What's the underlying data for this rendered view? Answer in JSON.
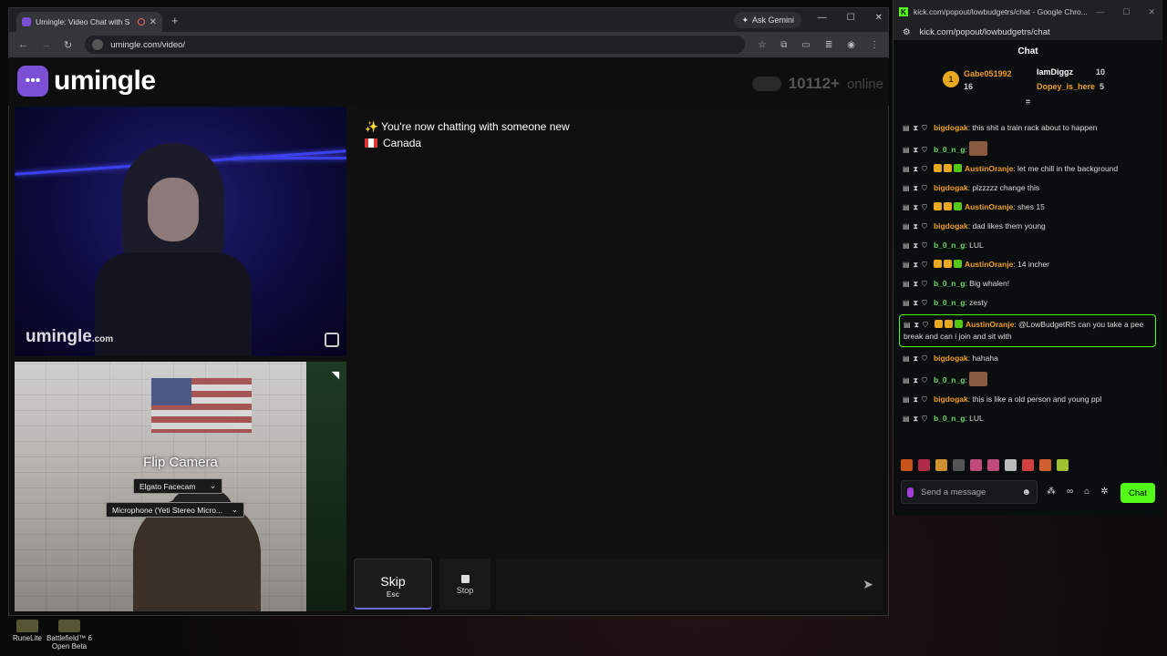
{
  "browser_left": {
    "tab_title": "Umingle: Video Chat with S",
    "ask_gemini": "Ask Gemini",
    "url": "umingle.com/video/"
  },
  "umingle": {
    "logo_text": "umingle",
    "online_count": "10112+",
    "online_label": "online",
    "watermark": "umingle",
    "watermark_suffix": ".com",
    "flip_camera": "Flip Camera",
    "camera_select": "Elgato Facecam",
    "mic_select": "Microphone (Yeti Stereo Micro...",
    "system_message": "✨ You're now chatting with someone new",
    "country": "Canada",
    "skip_label": "Skip",
    "skip_hint": "Esc",
    "stop_label": "Stop"
  },
  "browser_right": {
    "window_title": "kick.com/popout/lowbudgetrs/chat - Google Chro...",
    "url": "kick.com/popout/lowbudgetrs/chat",
    "header": "Chat"
  },
  "leaderboard": [
    {
      "name": "Gabe051992",
      "count": "16",
      "rank": "1"
    },
    {
      "name": "IamDiggz",
      "count": "10"
    },
    {
      "name": "Dopey_is_here",
      "count": "5"
    }
  ],
  "messages": [
    {
      "user": "bigdogak",
      "color": "#f0a020",
      "text": "this shit a train rack about to happen"
    },
    {
      "user": "b_0_n_g",
      "color": "#6fd76f",
      "text": ""
    },
    {
      "user": "AustinOranje",
      "color": "#f0a020",
      "text": "let me chill in the background"
    },
    {
      "user": "bigdogak",
      "color": "#f0a020",
      "text": "plzzzzz change this"
    },
    {
      "user": "AustinOranje",
      "color": "#f0a020",
      "text": "shes 15"
    },
    {
      "user": "bigdogak",
      "color": "#f0a020",
      "text": "dad likes them young"
    },
    {
      "user": "b_0_n_g",
      "color": "#6fd76f",
      "text": "LUL"
    },
    {
      "user": "AustinOranje",
      "color": "#f0a020",
      "text": "14 incher"
    },
    {
      "user": "b_0_n_g",
      "color": "#6fd76f",
      "text": "Big whalen!"
    },
    {
      "user": "b_0_n_g",
      "color": "#6fd76f",
      "text": "zesty"
    },
    {
      "user": "AustinOranje",
      "color": "#f0a020",
      "text": "@LowBudgetRS can you take a pee break and can i join and sit with"
    },
    {
      "user": "bigdogak",
      "color": "#f0a020",
      "text": "hahaha"
    },
    {
      "user": "b_0_n_g",
      "color": "#6fd76f",
      "text": ""
    },
    {
      "user": "bigdogak",
      "color": "#f0a020",
      "text": "this is like a old person and young ppl"
    },
    {
      "user": "b_0_n_g",
      "color": "#6fd76f",
      "text": "LUL"
    }
  ],
  "chat_input": {
    "placeholder": "Send a message",
    "send_label": "Chat"
  },
  "desktop": {
    "icon1": "RuneLite",
    "icon2": "Battlefield™ 6 Open Beta"
  }
}
